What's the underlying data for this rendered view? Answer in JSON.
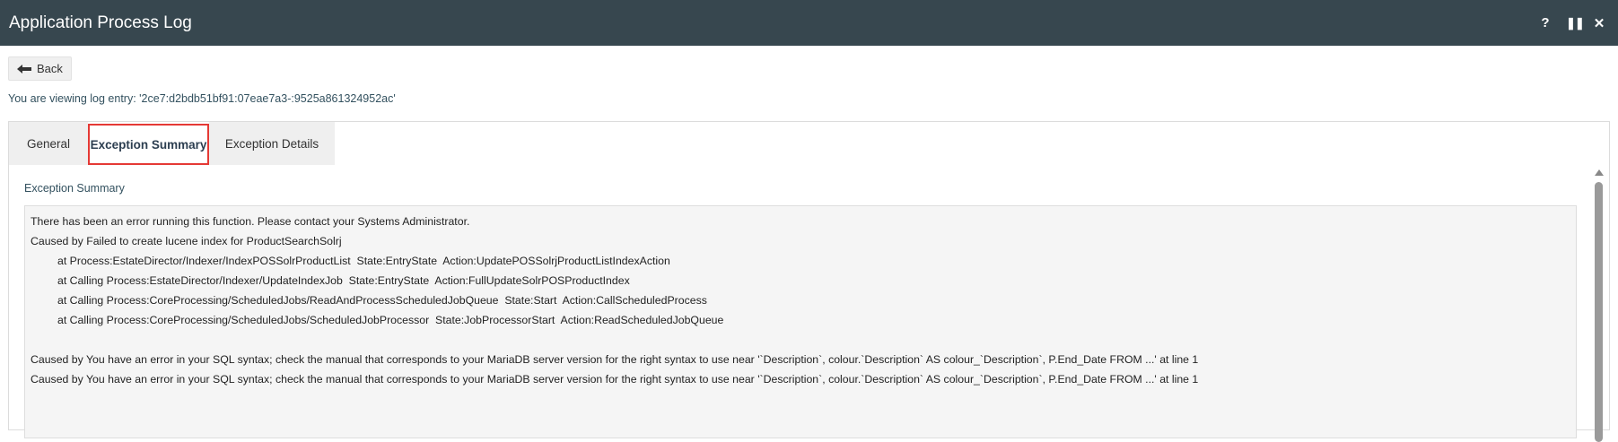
{
  "window": {
    "title": "Application Process Log",
    "controls": {
      "help": "?",
      "pause": "❚❚",
      "close": "✕"
    }
  },
  "toolbar": {
    "back_label": "Back"
  },
  "viewing_text": "You are viewing log entry: '2ce7:d2bdb51bf91:07eae7a3-:9525a861324952ac'",
  "tabs": [
    {
      "label": "General"
    },
    {
      "label": "Exception Summary"
    },
    {
      "label": "Exception Details"
    }
  ],
  "section_label": "Exception Summary",
  "exception_lines": [
    "There has been an error running this function. Please contact your Systems Administrator.",
    "Caused by Failed to create lucene index for ProductSearchSolrj",
    "at Process:EstateDirector/Indexer/IndexPOSSolrProductList  State:EntryState  Action:UpdatePOSSolrjProductListIndexAction",
    "at Calling Process:EstateDirector/Indexer/UpdateIndexJob  State:EntryState  Action:FullUpdateSolrPOSProductIndex",
    "at Calling Process:CoreProcessing/ScheduledJobs/ReadAndProcessScheduledJobQueue  State:Start  Action:CallScheduledProcess",
    "at Calling Process:CoreProcessing/ScheduledJobs/ScheduledJobProcessor  State:JobProcessorStart  Action:ReadScheduledJobQueue",
    "",
    "Caused by You have an error in your SQL syntax; check the manual that corresponds to your MariaDB server version for the right syntax to use near '`Description`, colour.`Description` AS colour_`Description`, P.End_Date FROM ...' at line 1",
    "Caused by You have an error in your SQL syntax; check the manual that corresponds to your MariaDB server version for the right syntax to use near '`Description`, colour.`Description` AS colour_`Description`, P.End_Date FROM ...' at line 1"
  ],
  "colors": {
    "titlebar": "#37474f",
    "active_tab_outline": "#e53935"
  }
}
